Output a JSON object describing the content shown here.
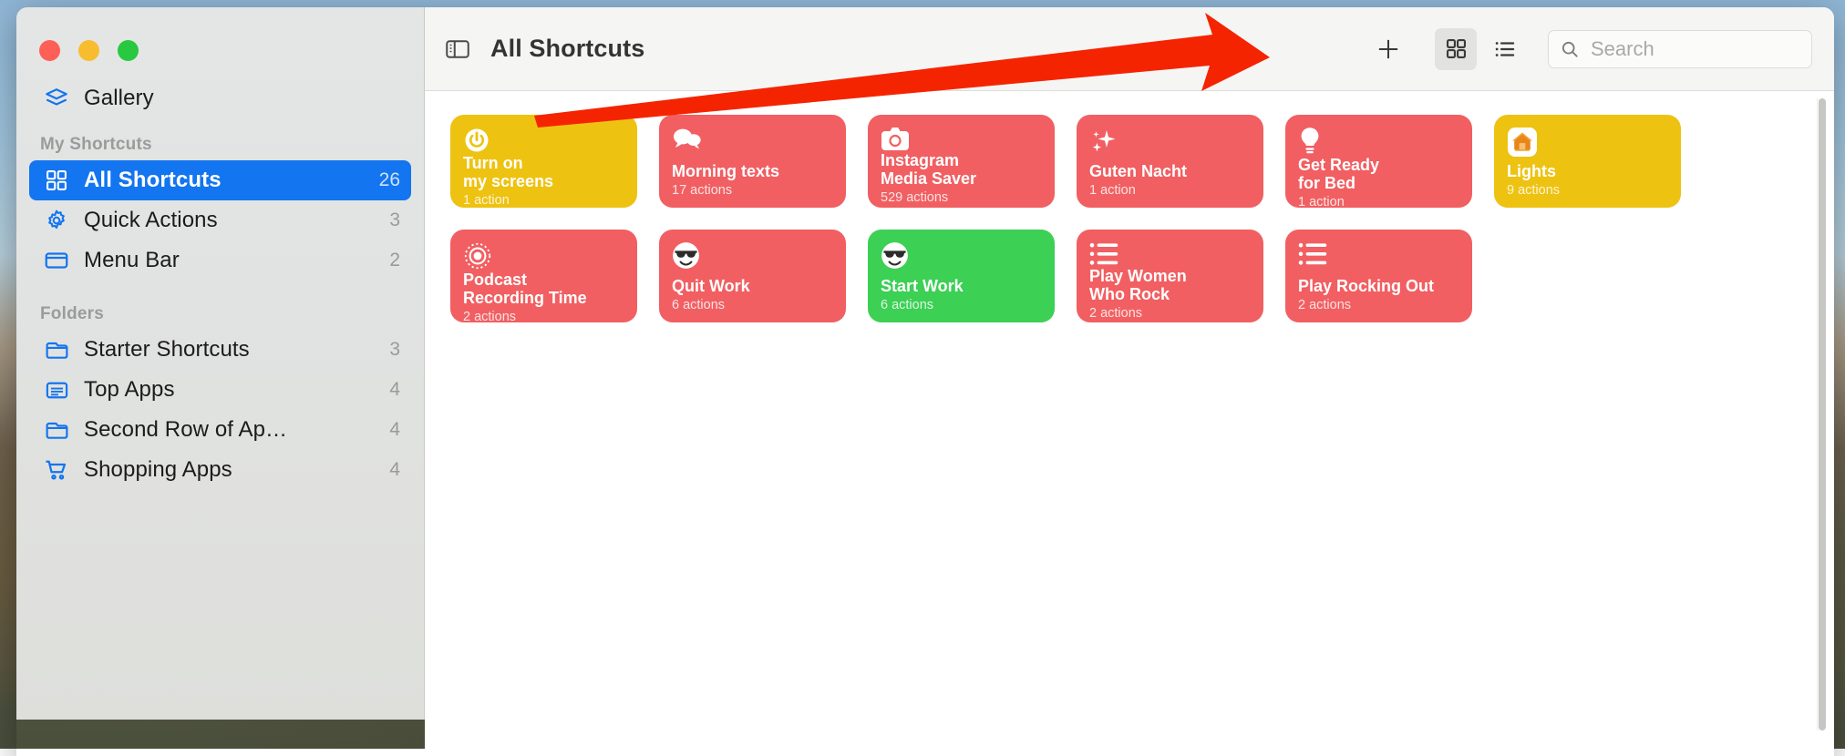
{
  "window": {
    "traffic_lights": [
      "close",
      "minimize",
      "zoom"
    ]
  },
  "sidebar": {
    "top_item": {
      "label": "Gallery",
      "icon": "gallery-layers-icon"
    },
    "groups": [
      {
        "title": "My Shortcuts",
        "items": [
          {
            "label": "All Shortcuts",
            "count": "26",
            "icon": "grid-icon",
            "selected": true
          },
          {
            "label": "Quick Actions",
            "count": "3",
            "icon": "gear-icon",
            "selected": false
          },
          {
            "label": "Menu Bar",
            "count": "2",
            "icon": "menubar-icon",
            "selected": false
          }
        ]
      },
      {
        "title": "Folders",
        "items": [
          {
            "label": "Starter Shortcuts",
            "count": "3",
            "icon": "folder-icon",
            "selected": false
          },
          {
            "label": "Top Apps",
            "count": "4",
            "icon": "list-card-icon",
            "selected": false
          },
          {
            "label": "Second Row of Ap…",
            "count": "4",
            "icon": "folder-icon",
            "selected": false
          },
          {
            "label": "Shopping Apps",
            "count": "4",
            "icon": "cart-icon",
            "selected": false
          }
        ]
      }
    ]
  },
  "toolbar": {
    "sidebar_toggle_icon": "sidebar-toggle-icon",
    "title": "All Shortcuts",
    "add_label": "+",
    "grid_view_icon": "grid-view-icon",
    "list_view_icon": "list-view-icon",
    "search": {
      "placeholder": "Search",
      "value": "",
      "icon": "search-icon"
    }
  },
  "colors": {
    "accent_blue": "#1375ef",
    "card_yellow": "#eec211",
    "card_red": "#f15f62",
    "card_green": "#3cd055",
    "annotation_red": "#f52400"
  },
  "shortcuts": [
    {
      "name": "Turn on\nmy screens",
      "actions": "1 action",
      "color": "#eec211",
      "icon": "power-icon"
    },
    {
      "name": "Morning texts",
      "actions": "17 actions",
      "color": "#f15f62",
      "icon": "messages-bubbles-icon"
    },
    {
      "name": "Instagram\nMedia Saver",
      "actions": "529 actions",
      "color": "#f15f62",
      "icon": "camera-icon"
    },
    {
      "name": "Guten Nacht",
      "actions": "1 action",
      "color": "#f15f62",
      "icon": "sparkles-icon"
    },
    {
      "name": "Get Ready\nfor Bed",
      "actions": "1 action",
      "color": "#f15f62",
      "icon": "lightbulb-icon"
    },
    {
      "name": "Lights",
      "actions": "9 actions",
      "color": "#eec211",
      "icon": "home-app-icon"
    },
    {
      "name": "Podcast\nRecording Time",
      "actions": "2 actions",
      "color": "#f15f62",
      "icon": "radio-waves-icon"
    },
    {
      "name": "Quit Work",
      "actions": "6 actions",
      "color": "#f15f62",
      "icon": "sunglasses-face-icon"
    },
    {
      "name": "Start Work",
      "actions": "6 actions",
      "color": "#3cd055",
      "icon": "sunglasses-face-icon"
    },
    {
      "name": "Play Women\nWho Rock",
      "actions": "2 actions",
      "color": "#f15f62",
      "icon": "playlist-icon"
    },
    {
      "name": "Play Rocking Out",
      "actions": "2 actions",
      "color": "#f15f62",
      "icon": "playlist-icon"
    }
  ],
  "annotation": {
    "type": "arrow",
    "points_to": "add-shortcut-button",
    "color": "#f52400"
  }
}
